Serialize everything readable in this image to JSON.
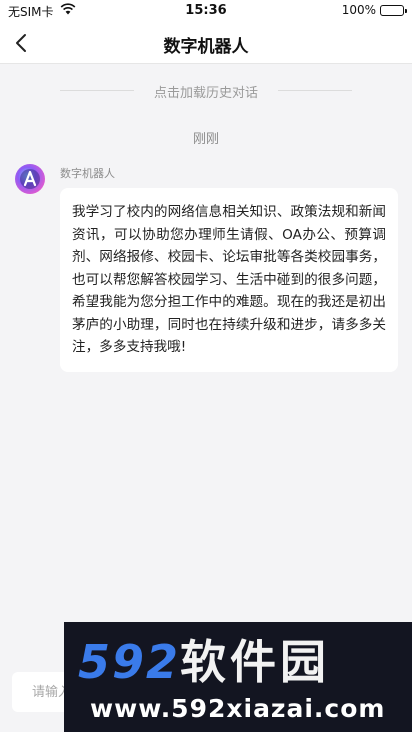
{
  "status_bar": {
    "carrier": "无SIM卡",
    "time": "15:36",
    "battery": "100%"
  },
  "nav": {
    "title": "数字机器人"
  },
  "chat": {
    "load_history": "点击加载历史对话",
    "timestamp": "刚刚",
    "messages": [
      {
        "sender": "数字机器人",
        "text": "我学习了校内的网络信息相关知识、政策法规和新闻资讯，可以协助您办理师生请假、OA办公、预算调剂、网络报修、校园卡、论坛审批等各类校园事务，也可以帮您解答校园学习、生活中碰到的很多问题，希望我能为您分担工作中的难题。现在的我还是初出茅庐的小助理，同时也在持续升级和进步，请多多关注，多多支持我哦!"
      }
    ]
  },
  "input": {
    "placeholder": "请输入"
  },
  "watermark": {
    "brand_num": "592",
    "brand_cn": "软件园",
    "site": "www.592xiazai.com"
  }
}
